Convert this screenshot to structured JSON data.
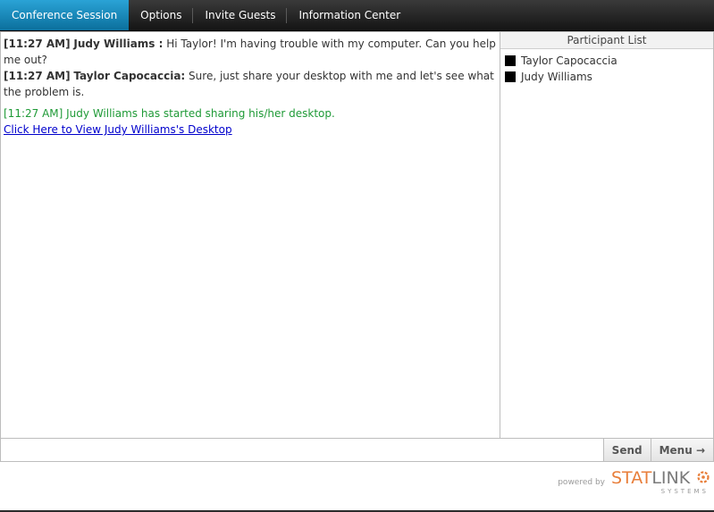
{
  "tabs": [
    {
      "label": "Conference Session",
      "active": true
    },
    {
      "label": "Options",
      "active": false
    },
    {
      "label": "Invite Guests",
      "active": false
    },
    {
      "label": "Information Center",
      "active": false
    }
  ],
  "chat": {
    "messages": [
      {
        "time": "[11:27 AM]",
        "sender": "Judy Williams :",
        "text": " Hi Taylor! I'm having trouble with my computer. Can you help me out?"
      },
      {
        "time": "[11:27 AM]",
        "sender": "Taylor Capocaccia:",
        "text": " Sure, just share your desktop with me and let's see what the problem is."
      }
    ],
    "system_message": "[11:27 AM] Judy Williams has started sharing his/her desktop.",
    "link_text": "Click Here to View Judy Williams's Desktop"
  },
  "participants": {
    "header": "Participant List",
    "items": [
      "Taylor Capocaccia",
      "Judy Williams"
    ]
  },
  "input": {
    "value": "",
    "placeholder": ""
  },
  "buttons": {
    "send": "Send",
    "menu": "Menu →"
  },
  "footer": {
    "powered_by": "powered by",
    "logo_stat": "STAT",
    "logo_link": "LINK",
    "logo_sub": "SYSTEMS"
  },
  "colors": {
    "active_tab": "#1a8fc2",
    "system_message": "#1f9a37",
    "link": "#0000cc",
    "logo_accent": "#e87e3a"
  }
}
